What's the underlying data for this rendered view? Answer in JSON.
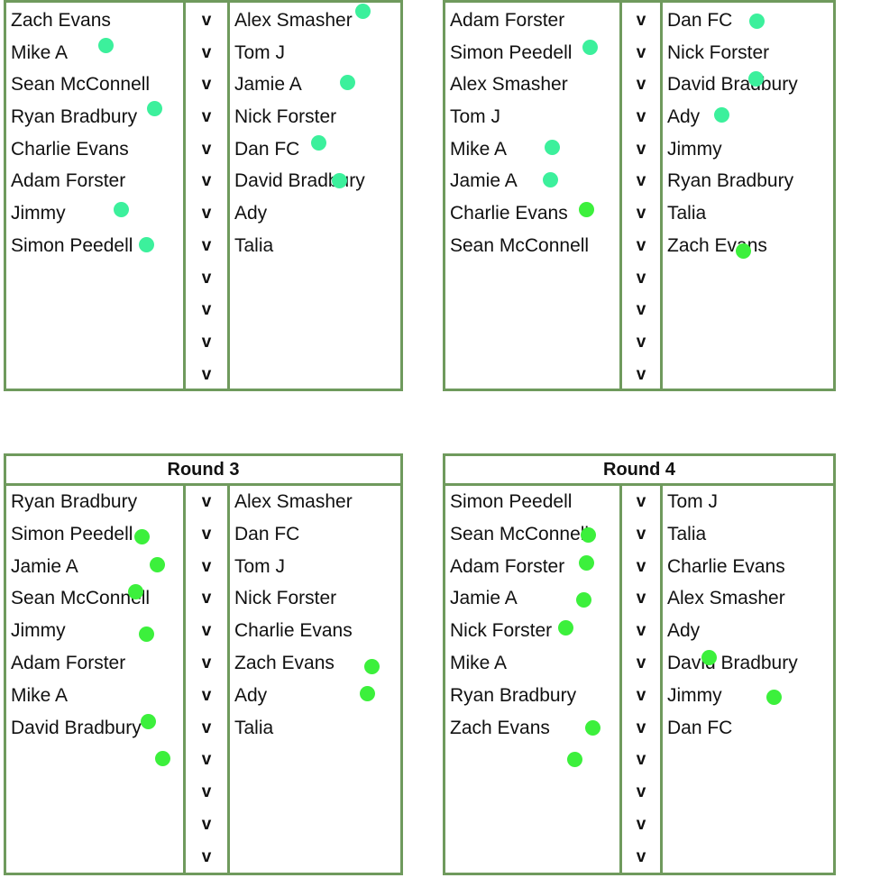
{
  "colors": {
    "border": "#6f9a5d",
    "dot_teal": "#3cf09c",
    "dot_green": "#3cf03c"
  },
  "vs_label": "v",
  "rounds": [
    {
      "title": "",
      "fixtures": [
        {
          "home": "Zach Evans",
          "away": "Alex Smasher",
          "marked": "away"
        },
        {
          "home": "Mike A",
          "away": "Tom J",
          "marked": "home"
        },
        {
          "home": "Sean McConnell",
          "away": "Jamie A",
          "marked": "away"
        },
        {
          "home": "Ryan Bradbury",
          "away": "Nick Forster",
          "marked": "home"
        },
        {
          "home": "Charlie Evans",
          "away": "Dan FC",
          "marked": "away"
        },
        {
          "home": "Adam Forster",
          "away": "David Bradbury",
          "marked": "away"
        },
        {
          "home": "Jimmy",
          "away": "Ady",
          "marked": "home"
        },
        {
          "home": "Simon Peedell",
          "away": "Talia",
          "marked": "home"
        },
        {
          "home": "",
          "away": ""
        },
        {
          "home": "",
          "away": ""
        },
        {
          "home": "",
          "away": ""
        },
        {
          "home": "",
          "away": ""
        }
      ]
    },
    {
      "title": "",
      "fixtures": [
        {
          "home": "Adam Forster",
          "away": "Dan FC",
          "marked": "away"
        },
        {
          "home": "Simon Peedell",
          "away": "Nick Forster",
          "marked": "home"
        },
        {
          "home": "Alex Smasher",
          "away": "David Bradbury",
          "marked": "away"
        },
        {
          "home": "Tom J",
          "away": "Ady",
          "marked": "away"
        },
        {
          "home": "Mike A",
          "away": "Jimmy",
          "marked": "home"
        },
        {
          "home": "Jamie A",
          "away": "Ryan Bradbury",
          "marked": "home"
        },
        {
          "home": "Charlie Evans",
          "away": "Talia",
          "marked": "home"
        },
        {
          "home": "Sean McConnell",
          "away": "Zach Evans",
          "marked": "away"
        },
        {
          "home": "",
          "away": ""
        },
        {
          "home": "",
          "away": ""
        },
        {
          "home": "",
          "away": ""
        },
        {
          "home": "",
          "away": ""
        }
      ]
    },
    {
      "title": "Round 3",
      "fixtures": [
        {
          "home": "Ryan Bradbury",
          "away": "Alex Smasher",
          "marked": "home"
        },
        {
          "home": "Simon Peedell",
          "away": "Dan FC",
          "marked": "home"
        },
        {
          "home": "Jamie A",
          "away": "Tom J",
          "marked": "home"
        },
        {
          "home": "Sean McConnell",
          "away": "Nick Forster",
          "marked": "home"
        },
        {
          "home": "Jimmy",
          "away": "Charlie Evans",
          "marked": "away"
        },
        {
          "home": "Adam Forster",
          "away": "Zach Evans",
          "marked": "away"
        },
        {
          "home": "Mike A",
          "away": "Ady",
          "marked": "home"
        },
        {
          "home": "David Bradbury",
          "away": "Talia",
          "marked": "home"
        },
        {
          "home": "",
          "away": ""
        },
        {
          "home": "",
          "away": ""
        },
        {
          "home": "",
          "away": ""
        },
        {
          "home": "",
          "away": ""
        }
      ]
    },
    {
      "title": "Round 4",
      "fixtures": [
        {
          "home": "Simon Peedell",
          "away": "Tom J",
          "marked": "home"
        },
        {
          "home": "Sean McConnell",
          "away": "Talia",
          "marked": "home"
        },
        {
          "home": "Adam Forster",
          "away": "Charlie Evans",
          "marked": "home"
        },
        {
          "home": "Jamie A",
          "away": "Alex Smasher",
          "marked": "home"
        },
        {
          "home": "Nick Forster",
          "away": "Ady",
          "marked": "away"
        },
        {
          "home": "Mike A",
          "away": "David Bradbury",
          "marked": "away"
        },
        {
          "home": "Ryan Bradbury",
          "away": "Jimmy",
          "marked": "home"
        },
        {
          "home": "Zach Evans",
          "away": "Dan FC",
          "marked": "home"
        },
        {
          "home": "",
          "away": ""
        },
        {
          "home": "",
          "away": ""
        },
        {
          "home": "",
          "away": ""
        },
        {
          "home": "",
          "away": ""
        }
      ]
    }
  ]
}
